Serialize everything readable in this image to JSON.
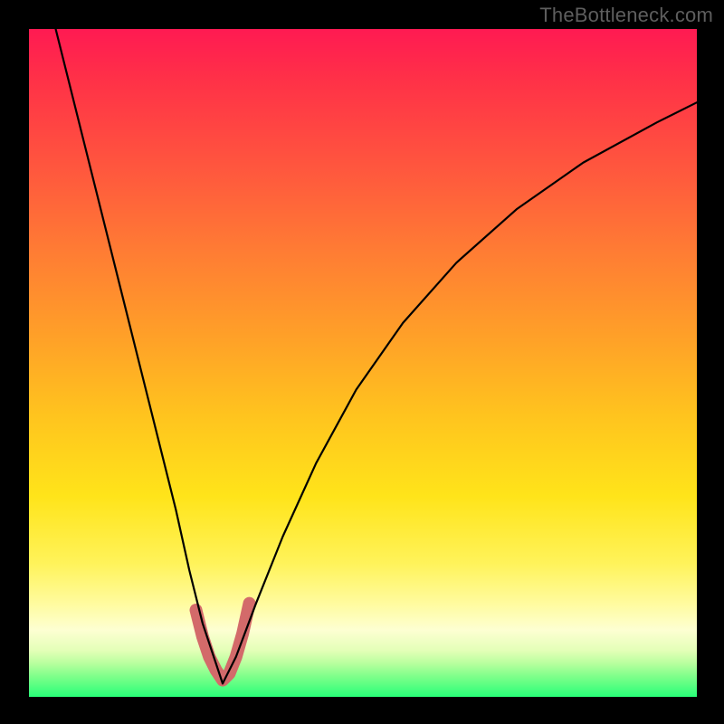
{
  "watermark": "TheBottleneck.com",
  "chart_data": {
    "type": "line",
    "title": "",
    "xlabel": "",
    "ylabel": "",
    "xlim": [
      0,
      1
    ],
    "ylim": [
      0,
      1
    ],
    "grid": false,
    "legend": false,
    "description": "Two black curves on a vertical red-to-green gradient. Left curve descends steeply from top-left to a minimum near x≈0.29 at the bottom; right curve rises from that minimum toward the upper-right with decreasing slope. A short thick pink/red segment highlights the trough (x≈0.25–0.33) near the bottom.",
    "series": [
      {
        "name": "left-curve",
        "x": [
          0.04,
          0.06,
          0.08,
          0.1,
          0.12,
          0.14,
          0.16,
          0.18,
          0.2,
          0.22,
          0.24,
          0.26,
          0.28,
          0.29
        ],
        "values": [
          1.0,
          0.92,
          0.84,
          0.76,
          0.68,
          0.6,
          0.52,
          0.44,
          0.36,
          0.28,
          0.19,
          0.11,
          0.05,
          0.02
        ]
      },
      {
        "name": "right-curve",
        "x": [
          0.29,
          0.31,
          0.34,
          0.38,
          0.43,
          0.49,
          0.56,
          0.64,
          0.73,
          0.83,
          0.94,
          1.0
        ],
        "values": [
          0.02,
          0.06,
          0.14,
          0.24,
          0.35,
          0.46,
          0.56,
          0.65,
          0.73,
          0.8,
          0.86,
          0.89
        ]
      },
      {
        "name": "highlight-trough",
        "x": [
          0.25,
          0.26,
          0.27,
          0.28,
          0.29,
          0.3,
          0.31,
          0.32,
          0.33
        ],
        "values": [
          0.13,
          0.09,
          0.06,
          0.04,
          0.025,
          0.035,
          0.06,
          0.095,
          0.14
        ]
      }
    ]
  }
}
